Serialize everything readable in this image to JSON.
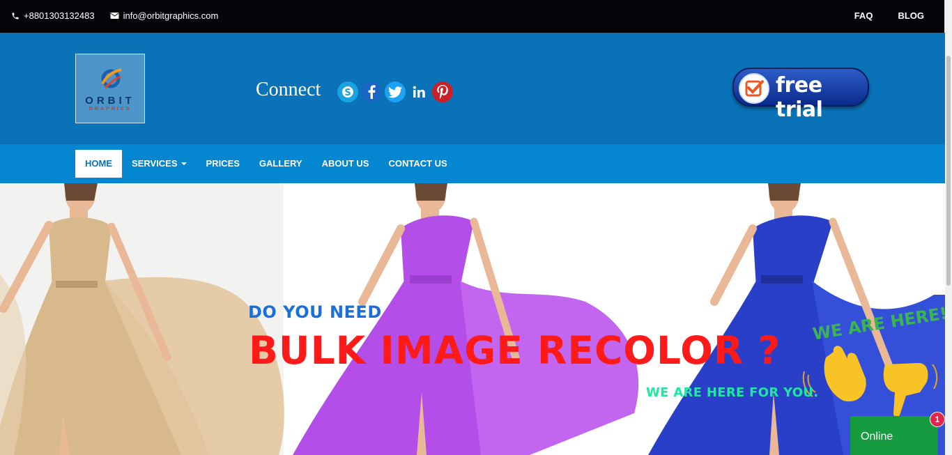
{
  "topbar": {
    "phone": "+8801303132483",
    "email": "info@orbitgraphics.com",
    "links": [
      "FAQ",
      "BLOG"
    ]
  },
  "header": {
    "logo_text": "ORBIT",
    "logo_subtext": "GRAPHICS",
    "connect_label": "Connect",
    "social_icons": [
      "skype-icon",
      "facebook-icon",
      "twitter-icon",
      "linkedin-icon",
      "pinterest-icon"
    ],
    "trial_label": "free trial"
  },
  "nav": {
    "items": [
      "HOME",
      "SERVICES",
      "PRICES",
      "GALLERY",
      "ABOUT US",
      "CONTACT US"
    ],
    "active": "HOME"
  },
  "hero": {
    "line1": "DO YOU NEED",
    "line2": "BULK IMAGE RECOLOR ?",
    "line3": "WE ARE HERE FOR YOU.",
    "dress_colors": [
      "#d8b98c",
      "#b44ee8",
      "#2a3fc8"
    ]
  },
  "chat": {
    "callout": "WE ARE HERE!",
    "status": "Online",
    "unread_count": "1"
  },
  "colors": {
    "topbar": "#050308",
    "header": "#0a72b6",
    "nav": "#0586d0",
    "headline_red": "#ff1a1a",
    "online_green": "#179b41"
  }
}
